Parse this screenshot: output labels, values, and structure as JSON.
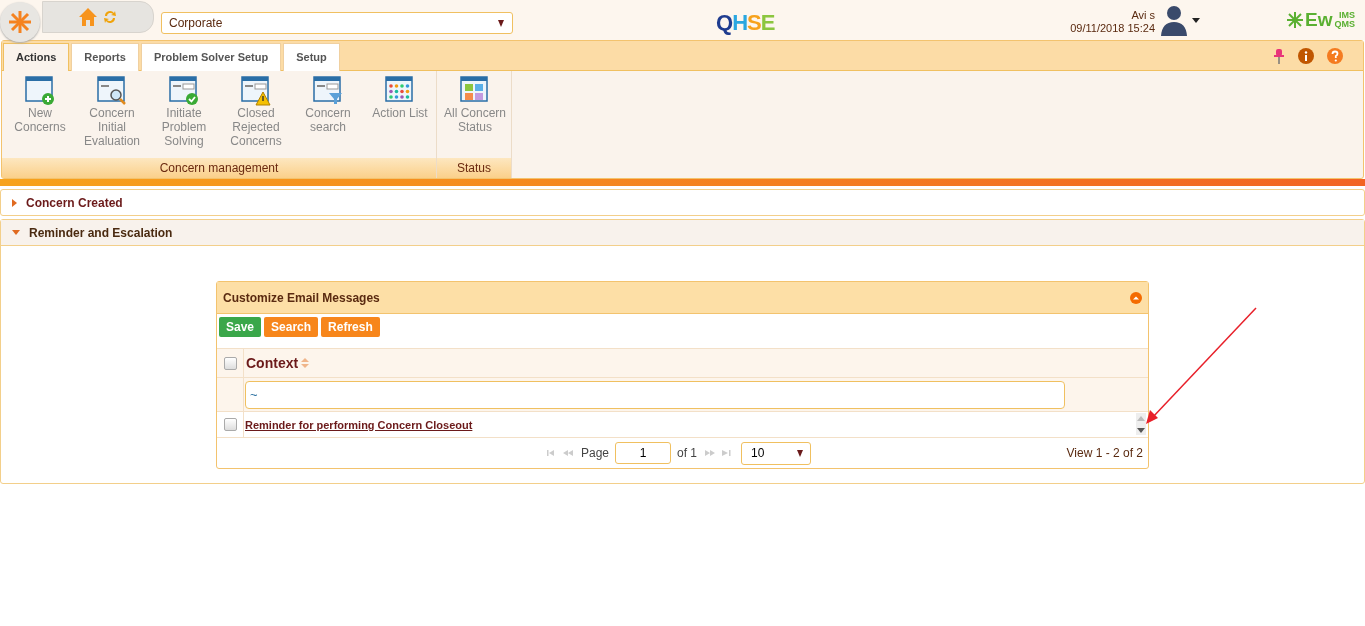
{
  "header": {
    "org_select": "Corporate",
    "logo_letters": [
      {
        "text": "Q",
        "color": "#1f3c8f"
      },
      {
        "text": "H",
        "color": "#2aa7e0"
      },
      {
        "text": "S",
        "color": "#f7a21b"
      },
      {
        "text": "E",
        "color": "#8cc63f"
      }
    ],
    "user": "Avi s",
    "datetime": "09/11/2018 15:24",
    "brand": {
      "main": "Ew",
      "top": "IMS",
      "bottom": "QMS"
    }
  },
  "tabs": [
    {
      "label": "Actions",
      "selected": true
    },
    {
      "label": "Reports",
      "selected": false
    },
    {
      "label": "Problem Solver Setup",
      "selected": false
    },
    {
      "label": "Setup",
      "selected": false
    }
  ],
  "ribbon_groups": [
    {
      "label": "Concern management",
      "items": [
        {
          "label": "New Concerns",
          "kind": "add"
        },
        {
          "label": "Concern Initial Evaluation",
          "kind": "magnify"
        },
        {
          "label": "Initiate Problem Solving",
          "kind": "check"
        },
        {
          "label": "Closed Rejected Concerns",
          "kind": "warning"
        },
        {
          "label": "Concern search",
          "kind": "filter"
        },
        {
          "label": "Action List",
          "kind": "grid"
        }
      ]
    },
    {
      "label": "Status",
      "items": [
        {
          "label": "All Concern Status",
          "kind": "tiles"
        }
      ]
    }
  ],
  "sections": [
    {
      "title": "Concern Created",
      "expanded": false
    },
    {
      "title": "Reminder and Escalation",
      "expanded": true
    }
  ],
  "panel": {
    "title": "Customize Email Messages",
    "buttons": [
      {
        "label": "Save",
        "kind": "save"
      },
      {
        "label": "Search",
        "kind": "action"
      },
      {
        "label": "Refresh",
        "kind": "action"
      }
    ],
    "header_checked": false,
    "column": "Context",
    "filter_value": "~",
    "rows": [
      {
        "text": "Reminder for performing Concern Closeout",
        "checked": false
      }
    ],
    "pager": {
      "page_label": "Page",
      "page": "1",
      "of": "of 1",
      "page_size": "10",
      "summary": "View 1 - 2 of 2"
    }
  }
}
